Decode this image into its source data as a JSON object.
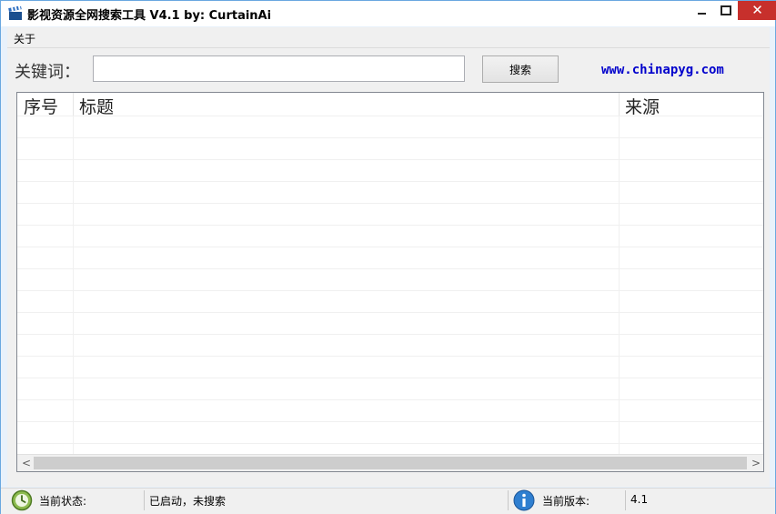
{
  "window": {
    "title": "影视资源全网搜索工具 V4.1 by:  CurtainAi",
    "icon": "clapperboard-icon",
    "close_glyph": "✕"
  },
  "menu": {
    "items": [
      {
        "label": "关于"
      }
    ]
  },
  "search": {
    "label": "关键词：",
    "value": "",
    "button_label": "搜索",
    "site_link": "www.chinapyg.com"
  },
  "table": {
    "columns": [
      "序号",
      "标题",
      "来源"
    ],
    "rows": []
  },
  "scrollbar": {
    "left_arrow": "<",
    "right_arrow": ">"
  },
  "status": {
    "state_label": "当前状态:",
    "state_value": "已启动，未搜索",
    "version_label": "当前版本:",
    "version_value": "4.1",
    "state_icon": "clock-icon",
    "version_icon": "info-icon"
  },
  "colors": {
    "close_button": "#c7302c",
    "link": "#0000cc",
    "window_border": "#6aa8e0"
  }
}
